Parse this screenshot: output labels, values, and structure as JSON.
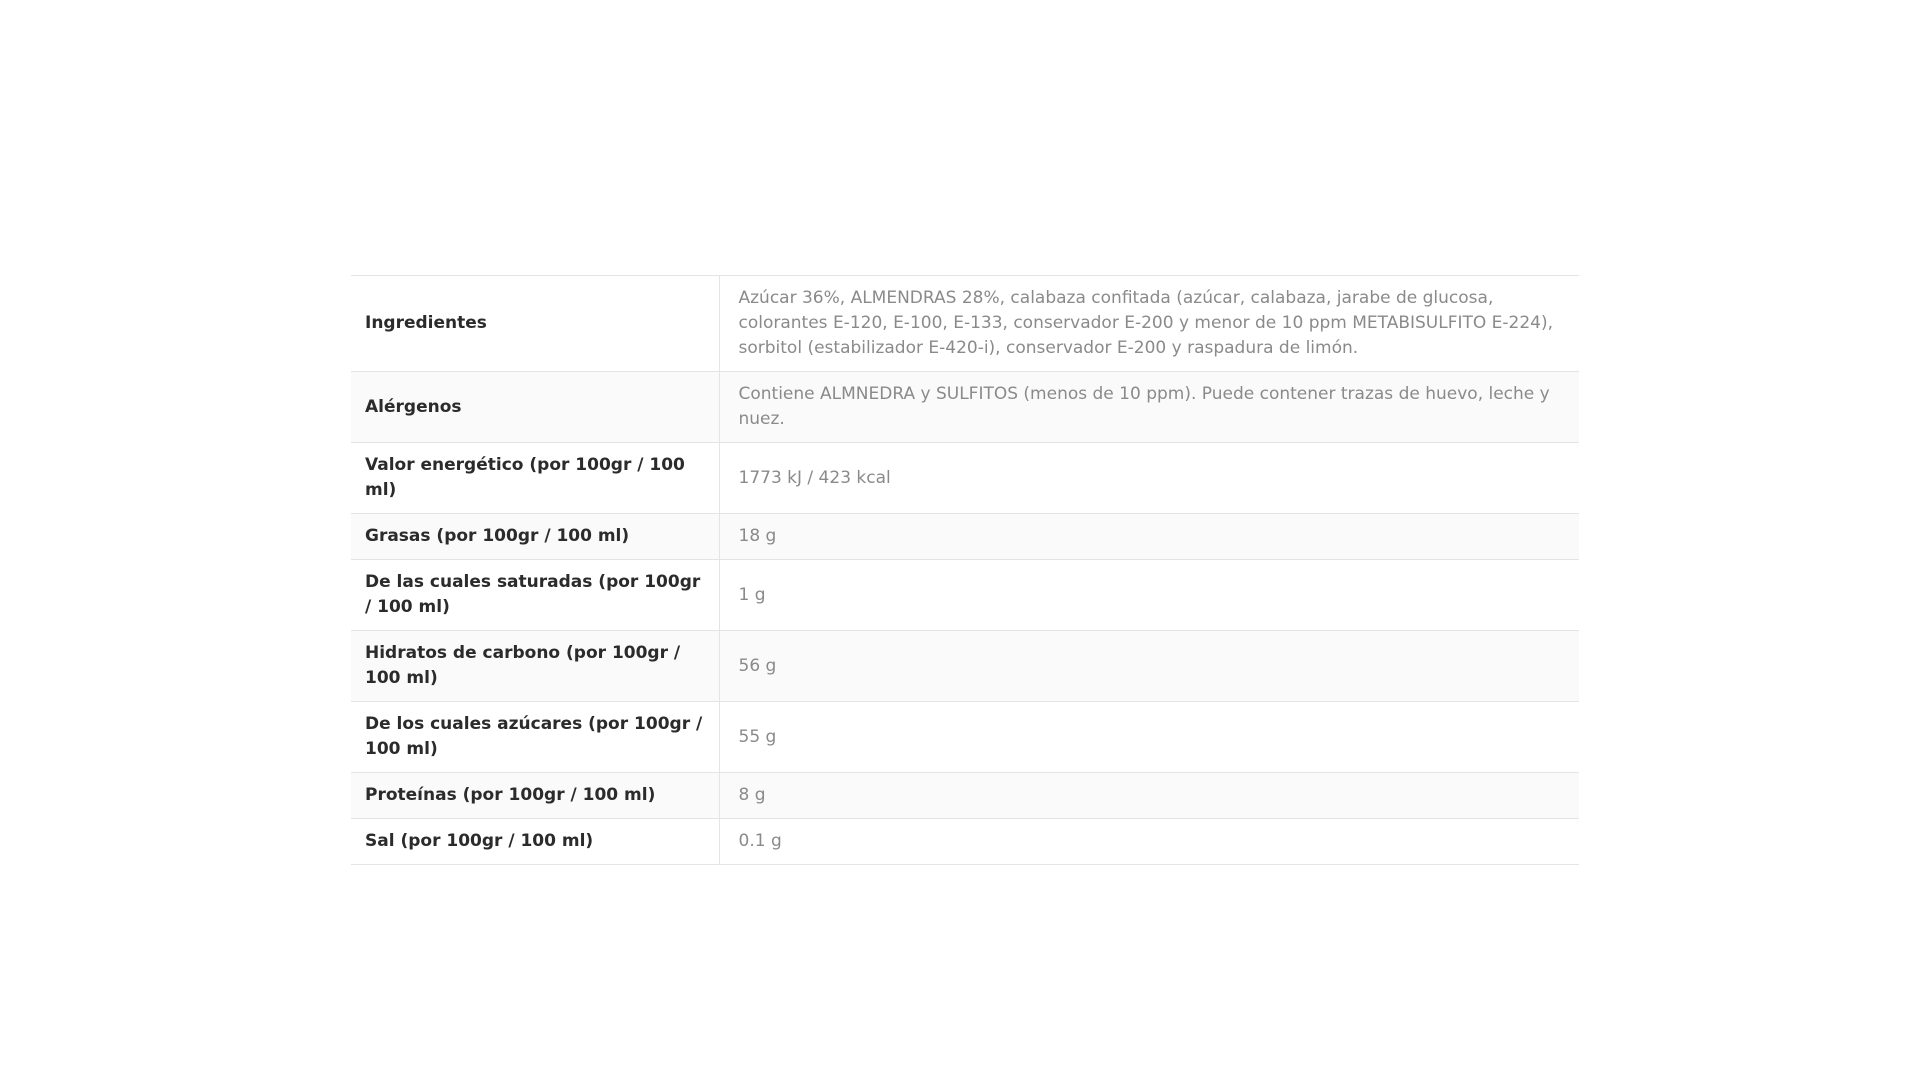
{
  "product_attributes": {
    "rows": [
      {
        "label": "Ingredientes",
        "value": "Azúcar 36%, ALMENDRAS 28%, calabaza confitada (azúcar, calabaza, jarabe de glucosa, colorantes E-120, E-100, E-133, conservador E-200 y menor de 10 ppm METABISULFITO E-224), sorbitol (estabilizador E-420-i), conservador E-200 y raspadura de limón."
      },
      {
        "label": "Alérgenos",
        "value": "Contiene ALMNEDRA y SULFITOS (menos de 10 ppm). Puede contener trazas de huevo, leche y nuez."
      },
      {
        "label": "Valor energético (por 100gr / 100 ml)",
        "value": "1773 kJ / 423 kcal"
      },
      {
        "label": "Grasas (por 100gr / 100 ml)",
        "value": "18 g"
      },
      {
        "label": "De las cuales saturadas (por 100gr / 100 ml)",
        "value": "1 g"
      },
      {
        "label": "Hidratos de carbono (por 100gr / 100 ml)",
        "value": "56 g"
      },
      {
        "label": "De los cuales azúcares (por 100gr / 100 ml)",
        "value": "55 g"
      },
      {
        "label": "Proteínas (por 100gr / 100 ml)",
        "value": "8 g"
      },
      {
        "label": "Sal (por 100gr / 100 ml)",
        "value": "0.1 g"
      }
    ]
  }
}
